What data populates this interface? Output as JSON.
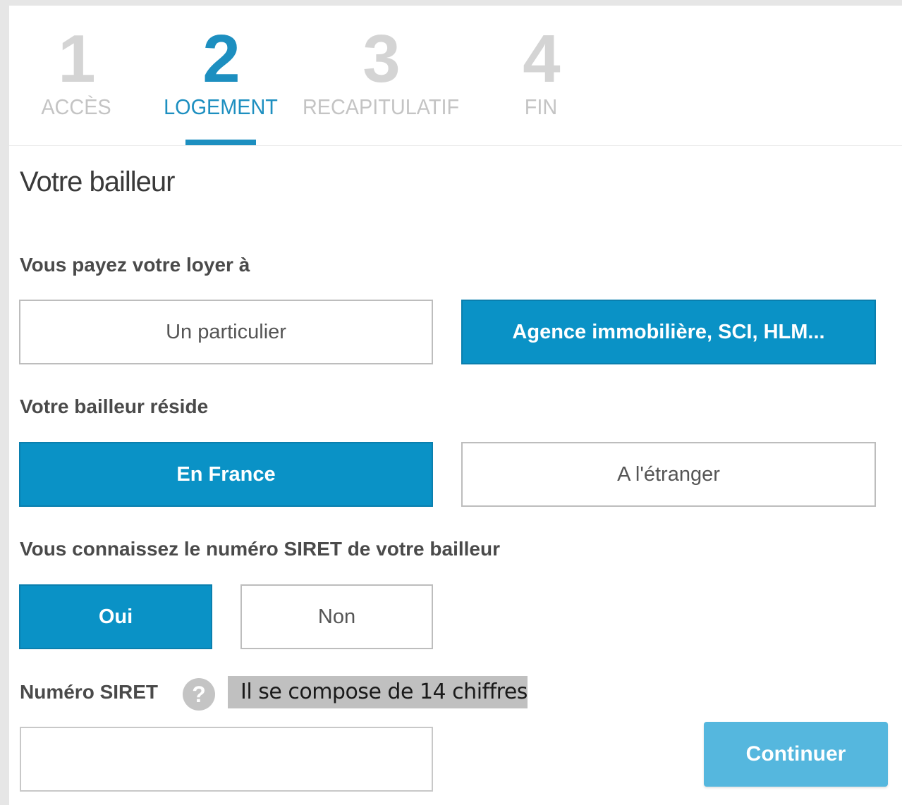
{
  "stepper": {
    "steps": [
      {
        "number": "1",
        "label": "ACCÈS",
        "state": "done"
      },
      {
        "number": "2",
        "label": "LOGEMENT",
        "state": "active"
      },
      {
        "number": "3",
        "label": "RECAPITULATIF",
        "state": "upcoming"
      },
      {
        "number": "4",
        "label": "FIN",
        "state": "upcoming"
      }
    ]
  },
  "section": {
    "title": "Votre bailleur"
  },
  "rent_payee": {
    "question": "Vous payez votre loyer à",
    "options": [
      "Un particulier",
      "Agence immobilière, SCI, HLM..."
    ],
    "selected": "Agence immobilière, SCI, HLM..."
  },
  "landlord_residence": {
    "question": "Votre bailleur réside",
    "options": [
      "En France",
      "A l'étranger"
    ],
    "selected": "En France"
  },
  "siret_known": {
    "question": "Vous connaissez le numéro SIRET de votre bailleur",
    "options": [
      "Oui",
      "Non"
    ],
    "selected": "Oui"
  },
  "siret": {
    "label": "Numéro SIRET",
    "help_icon": "question-icon",
    "help_glyph": "?",
    "tooltip": "Il se compose de 14 chiffres",
    "value": "",
    "placeholder": ""
  },
  "actions": {
    "continue_label": "Continuer"
  },
  "colors": {
    "accent": "#1d8fc0",
    "selected_button": "#0a92c6",
    "continue_button": "#55b7de",
    "inactive_step": "#d4d4d4",
    "tooltip_bg": "#c0c0c0"
  }
}
